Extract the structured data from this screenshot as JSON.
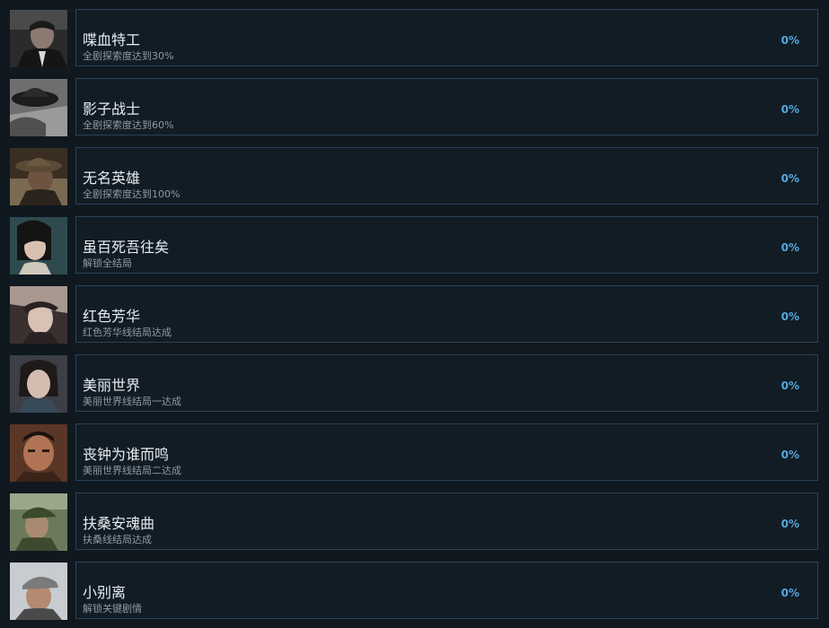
{
  "achievements": [
    {
      "title": "喋血特工",
      "description": "全剧探索度达到30%",
      "percent": "0%",
      "icon": "portrait-man-suit-icon"
    },
    {
      "title": "影子战士",
      "description": "全剧探索度达到60%",
      "percent": "0%",
      "icon": "fedora-hat-icon"
    },
    {
      "title": "无名英雄",
      "description": "全剧探索度达到100%",
      "percent": "0%",
      "icon": "portrait-man-hat-icon"
    },
    {
      "title": "虽百死吾往矣",
      "description": "解锁全结局",
      "percent": "0%",
      "icon": "portrait-woman-bob-icon"
    },
    {
      "title": "红色芳华",
      "description": "红色芳华线结局达成",
      "percent": "0%",
      "icon": "portrait-woman-cap-icon"
    },
    {
      "title": "美丽世界",
      "description": "美丽世界线结局一达成",
      "percent": "0%",
      "icon": "portrait-woman-icon"
    },
    {
      "title": "丧钟为谁而鸣",
      "description": "美丽世界线结局二达成",
      "percent": "0%",
      "icon": "portrait-man-icon"
    },
    {
      "title": "扶桑安魂曲",
      "description": "扶桑线结局达成",
      "percent": "0%",
      "icon": "portrait-soldier-icon"
    },
    {
      "title": "小别离",
      "description": "解锁关键剧情",
      "percent": "0%",
      "icon": "portrait-man-flatcap-icon"
    }
  ],
  "colors": {
    "background": "#101820",
    "card_border": "#2a4358",
    "title": "#e6edf2",
    "description": "#8e9aa4",
    "percent": "#56a8dd"
  }
}
